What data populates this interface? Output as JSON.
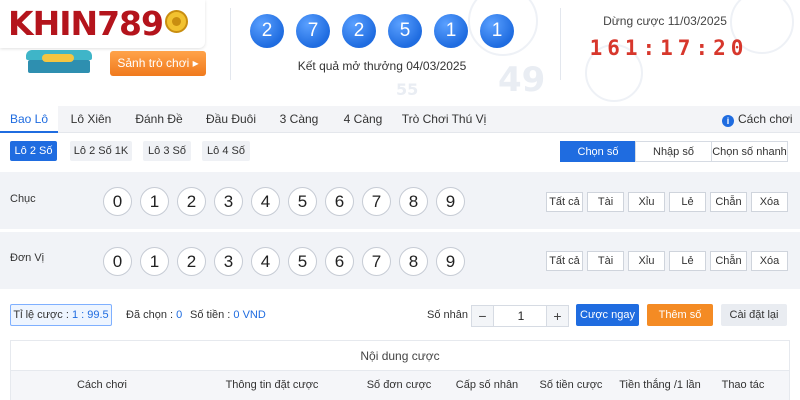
{
  "brand": {
    "logo_text": "KHIN789",
    "lobby_label": "Sảnh trò chơi ▸"
  },
  "header": {
    "result_balls": [
      "2",
      "7",
      "2",
      "5",
      "1",
      "1"
    ],
    "result_label": "Kết quả mở thưởng 04/03/2025",
    "deadline_label": "Dừng cược 11/03/2025",
    "countdown": "161:17:20",
    "watermark": [
      "49",
      "55"
    ]
  },
  "tabs": [
    "Bao Lô",
    "Lô Xiên",
    "Đánh Đề",
    "Đầu Đuôi",
    "3 Càng",
    "4 Càng",
    "Trò Chơi Thú Vị"
  ],
  "active_tab": "Bao Lô",
  "howto_label": "Cách chơi",
  "subtabs": [
    "Lô 2 Số",
    "Lô 2 Số 1K",
    "Lô 3 Số",
    "Lô 4 Số"
  ],
  "active_subtab": "Lô 2 Số",
  "input_modes": [
    "Chọn số",
    "Nhập số",
    "Chọn số nhanh"
  ],
  "active_mode": "Chọn số",
  "rows": [
    {
      "label": "Chục",
      "numbers": [
        "0",
        "1",
        "2",
        "3",
        "4",
        "5",
        "6",
        "7",
        "8",
        "9"
      ]
    },
    {
      "label": "Đơn Vị",
      "numbers": [
        "0",
        "1",
        "2",
        "3",
        "4",
        "5",
        "6",
        "7",
        "8",
        "9"
      ]
    }
  ],
  "quick_buttons": [
    "Tất cả",
    "Tài",
    "Xỉu",
    "Lẻ",
    "Chẵn",
    "Xóa"
  ],
  "bet": {
    "ratio_label": "Tỉ lệ cược : ",
    "ratio_value": "1 : 99.5",
    "selected_label": "Đã chọn : ",
    "selected_value": "0",
    "amount_label": "Số tiền : ",
    "amount_value": "0 VND",
    "multiplier_label": "Số nhân :",
    "multiplier_value": "1",
    "minus": "−",
    "plus": "+",
    "bet_now": "Cược ngay",
    "add_number": "Thêm số",
    "reset": "Cài đặt lại"
  },
  "table": {
    "title": "Nội dung cược",
    "columns": [
      "Cách chơi",
      "Thông tin đặt cược",
      "Số đơn cược",
      "Cấp số nhân",
      "Số tiền cược",
      "Tiền thắng /1 lần",
      "Thao tác"
    ]
  },
  "colors": {
    "primary": "#1f6ce0",
    "accent": "#f48b24",
    "brand": "#b4141c",
    "countdown": "#d7372c"
  }
}
